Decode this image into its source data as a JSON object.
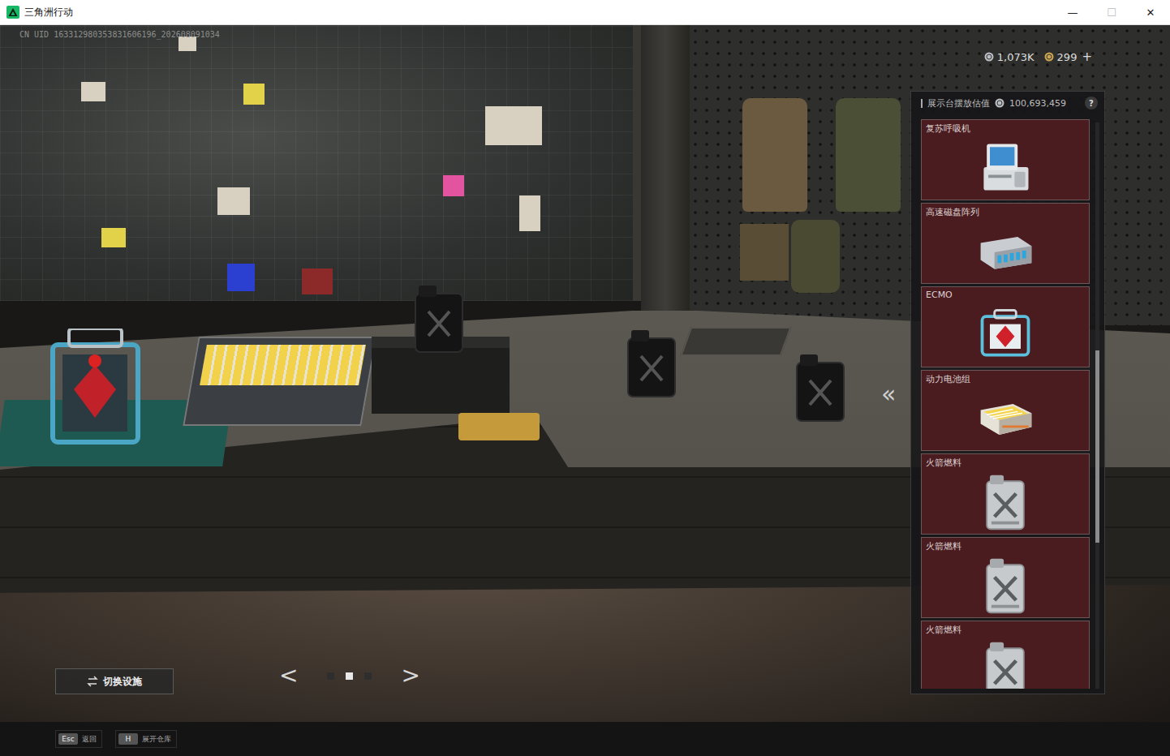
{
  "window": {
    "title": "三角洲行动",
    "controls": [
      {
        "label": "—",
        "disabled": false
      },
      {
        "label": "☐",
        "disabled": true
      },
      {
        "label": "✕",
        "disabled": false
      }
    ]
  },
  "hud": {
    "uid": "CN UID 163312980353831606196_202608091034",
    "currencies": [
      {
        "amount": "1,073K",
        "color": "#b9bcc0"
      },
      {
        "amount": "299",
        "color": "#c9a552"
      }
    ],
    "add": "+"
  },
  "display_panel": {
    "title": "展示台摆放估值",
    "value": "100,693,459",
    "help": "?",
    "collapse": "«",
    "scroll": {
      "position": 0.61,
      "visible_share": 0.34
    },
    "items": [
      {
        "label": "复苏呼吸机",
        "kind": "terminal"
      },
      {
        "label": "高速磁盘阵列",
        "kind": "disk"
      },
      {
        "label": "ECMO",
        "kind": "ecmo"
      },
      {
        "label": "动力电池组",
        "kind": "battery"
      },
      {
        "label": "火箭燃料",
        "kind": "fuel"
      },
      {
        "label": "火箭燃料",
        "kind": "fuel"
      },
      {
        "label": "火箭燃料",
        "kind": "fuel"
      }
    ]
  },
  "switch_button": "切换设施",
  "pager": {
    "prev": "<",
    "next": ">",
    "pages": [
      {
        "selected": false
      },
      {
        "selected": true
      },
      {
        "selected": false
      }
    ]
  },
  "hotkeys": [
    {
      "key": "Esc",
      "label": "返回"
    },
    {
      "key": "H",
      "label": "展开仓库"
    }
  ]
}
